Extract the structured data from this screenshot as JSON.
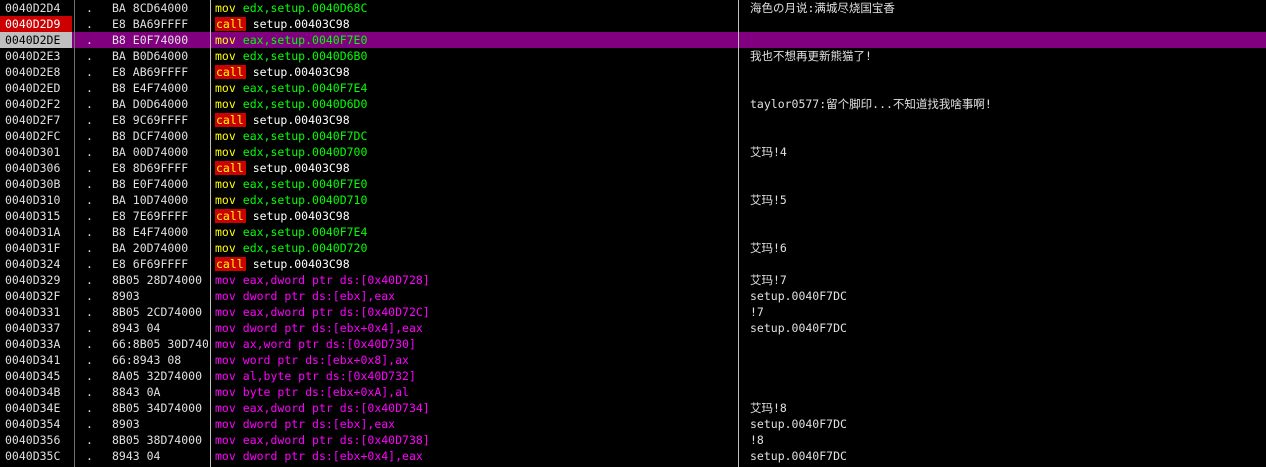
{
  "rows": [
    {
      "addr": "0040D2D4",
      "mark": ".",
      "hex": "BA 8CD64000",
      "mnem": "mov",
      "ops": "edx,setup.0040D68C",
      "tone": "mov-green",
      "comment": "海色の月说:满城尽烧国宝香"
    },
    {
      "addr": "0040D2D9",
      "mark": ".",
      "hex": "E8 BA69FFFF",
      "mnem": "call",
      "ops": "setup.00403C98",
      "tone": "call",
      "comment": "",
      "breakpoint": true
    },
    {
      "addr": "0040D2DE",
      "mark": ".",
      "hex": "B8 E0F74000",
      "mnem": "mov",
      "ops": "eax,setup.0040F7E0",
      "tone": "mov-green",
      "comment": "",
      "selected": true
    },
    {
      "addr": "0040D2E3",
      "mark": ".",
      "hex": "BA B0D64000",
      "mnem": "mov",
      "ops": "edx,setup.0040D6B0",
      "tone": "mov-green",
      "comment": "我也不想再更新熊猫了!"
    },
    {
      "addr": "0040D2E8",
      "mark": ".",
      "hex": "E8 AB69FFFF",
      "mnem": "call",
      "ops": "setup.00403C98",
      "tone": "call",
      "comment": ""
    },
    {
      "addr": "0040D2ED",
      "mark": ".",
      "hex": "B8 E4F74000",
      "mnem": "mov",
      "ops": "eax,setup.0040F7E4",
      "tone": "mov-green",
      "comment": ""
    },
    {
      "addr": "0040D2F2",
      "mark": ".",
      "hex": "BA D0D64000",
      "mnem": "mov",
      "ops": "edx,setup.0040D6D0",
      "tone": "mov-green",
      "comment": "taylor0577:留个脚印...不知道找我啥事啊!"
    },
    {
      "addr": "0040D2F7",
      "mark": ".",
      "hex": "E8 9C69FFFF",
      "mnem": "call",
      "ops": "setup.00403C98",
      "tone": "call",
      "comment": ""
    },
    {
      "addr": "0040D2FC",
      "mark": ".",
      "hex": "B8 DCF74000",
      "mnem": "mov",
      "ops": "eax,setup.0040F7DC",
      "tone": "mov-green",
      "comment": ""
    },
    {
      "addr": "0040D301",
      "mark": ".",
      "hex": "BA 00D74000",
      "mnem": "mov",
      "ops": "edx,setup.0040D700",
      "tone": "mov-green",
      "comment": "艾玛!4"
    },
    {
      "addr": "0040D306",
      "mark": ".",
      "hex": "E8 8D69FFFF",
      "mnem": "call",
      "ops": "setup.00403C98",
      "tone": "call",
      "comment": ""
    },
    {
      "addr": "0040D30B",
      "mark": ".",
      "hex": "B8 E0F74000",
      "mnem": "mov",
      "ops": "eax,setup.0040F7E0",
      "tone": "mov-green",
      "comment": ""
    },
    {
      "addr": "0040D310",
      "mark": ".",
      "hex": "BA 10D74000",
      "mnem": "mov",
      "ops": "edx,setup.0040D710",
      "tone": "mov-green",
      "comment": "艾玛!5"
    },
    {
      "addr": "0040D315",
      "mark": ".",
      "hex": "E8 7E69FFFF",
      "mnem": "call",
      "ops": "setup.00403C98",
      "tone": "call",
      "comment": ""
    },
    {
      "addr": "0040D31A",
      "mark": ".",
      "hex": "B8 E4F74000",
      "mnem": "mov",
      "ops": "eax,setup.0040F7E4",
      "tone": "mov-green",
      "comment": ""
    },
    {
      "addr": "0040D31F",
      "mark": ".",
      "hex": "BA 20D74000",
      "mnem": "mov",
      "ops": "edx,setup.0040D720",
      "tone": "mov-green",
      "comment": "艾玛!6"
    },
    {
      "addr": "0040D324",
      "mark": ".",
      "hex": "E8 6F69FFFF",
      "mnem": "call",
      "ops": "setup.00403C98",
      "tone": "call",
      "comment": ""
    },
    {
      "addr": "0040D329",
      "mark": ".",
      "hex": "8B05 28D74000",
      "mnem": "mov",
      "ops": "eax,dword ptr ds:[0x40D728]",
      "tone": "mem",
      "comment": "艾玛!7"
    },
    {
      "addr": "0040D32F",
      "mark": ".",
      "hex": "8903",
      "mnem": "mov",
      "ops": "dword ptr ds:[ebx],eax",
      "tone": "mem",
      "comment": "setup.0040F7DC"
    },
    {
      "addr": "0040D331",
      "mark": ".",
      "hex": "8B05 2CD74000",
      "mnem": "mov",
      "ops": "eax,dword ptr ds:[0x40D72C]",
      "tone": "mem",
      "comment": "!7"
    },
    {
      "addr": "0040D337",
      "mark": ".",
      "hex": "8943 04",
      "mnem": "mov",
      "ops": "dword ptr ds:[ebx+0x4],eax",
      "tone": "mem",
      "comment": "setup.0040F7DC"
    },
    {
      "addr": "0040D33A",
      "mark": ".",
      "hex": "66:8B05 30D740",
      "mnem": "mov",
      "ops": "ax,word ptr ds:[0x40D730]",
      "tone": "mem",
      "comment": ""
    },
    {
      "addr": "0040D341",
      "mark": ".",
      "hex": "66:8943 08",
      "mnem": "mov",
      "ops": "word ptr ds:[ebx+0x8],ax",
      "tone": "mem",
      "comment": ""
    },
    {
      "addr": "0040D345",
      "mark": ".",
      "hex": "8A05 32D74000",
      "mnem": "mov",
      "ops": "al,byte ptr ds:[0x40D732]",
      "tone": "mem",
      "comment": ""
    },
    {
      "addr": "0040D34B",
      "mark": ".",
      "hex": "8843 0A",
      "mnem": "mov",
      "ops": "byte ptr ds:[ebx+0xA],al",
      "tone": "mem",
      "comment": ""
    },
    {
      "addr": "0040D34E",
      "mark": ".",
      "hex": "8B05 34D74000",
      "mnem": "mov",
      "ops": "eax,dword ptr ds:[0x40D734]",
      "tone": "mem",
      "comment": "艾玛!8"
    },
    {
      "addr": "0040D354",
      "mark": ".",
      "hex": "8903",
      "mnem": "mov",
      "ops": "dword ptr ds:[ebx],eax",
      "tone": "mem",
      "comment": "setup.0040F7DC"
    },
    {
      "addr": "0040D356",
      "mark": ".",
      "hex": "8B05 38D74000",
      "mnem": "mov",
      "ops": "eax,dword ptr ds:[0x40D738]",
      "tone": "mem",
      "comment": "!8"
    },
    {
      "addr": "0040D35C",
      "mark": ".",
      "hex": "8943 04",
      "mnem": "mov",
      "ops": "dword ptr ds:[ebx+0x4],eax",
      "tone": "mem",
      "comment": "setup.0040F7DC"
    }
  ],
  "colors": {
    "background": "#000000",
    "selection": "#800080",
    "breakpoint": "#cc0000",
    "current_address": "#c0c0c0",
    "mnemonic_mov": "#ffff00",
    "operand_register": "#00ff00",
    "memory_operand": "#ff00ff"
  }
}
